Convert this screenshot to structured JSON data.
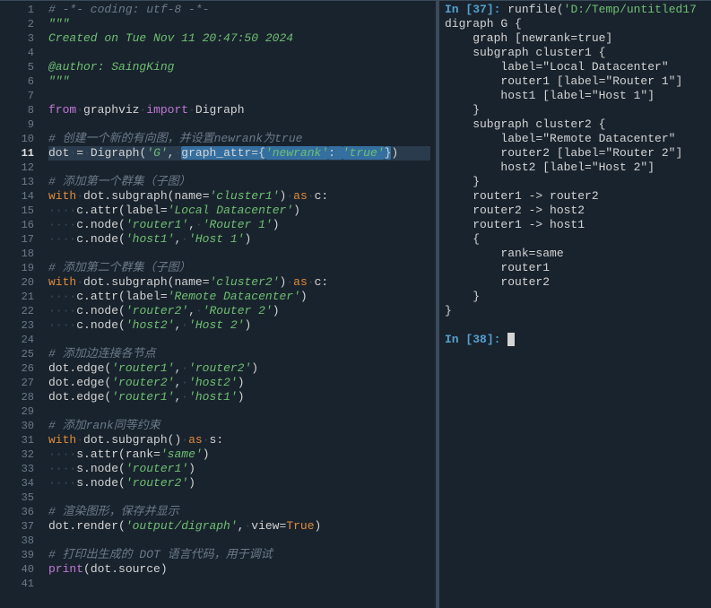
{
  "editor": {
    "current_line": 11,
    "lines": [
      {
        "n": 1,
        "seg": [
          [
            "com",
            "# -*- coding: utf-8 -*-"
          ]
        ],
        "ws": 0
      },
      {
        "n": 2,
        "seg": [
          [
            "str",
            "\"\"\""
          ]
        ],
        "ws": 0
      },
      {
        "n": 3,
        "seg": [
          [
            "str",
            "Created on Tue Nov 11 20:47:50 2024"
          ]
        ],
        "ws": 0
      },
      {
        "n": 4,
        "seg": [
          [
            "str",
            ""
          ]
        ],
        "ws": 0
      },
      {
        "n": 5,
        "seg": [
          [
            "str",
            "@author: SaingKing"
          ]
        ],
        "ws": 0
      },
      {
        "n": 6,
        "seg": [
          [
            "str",
            "\"\"\""
          ]
        ],
        "ws": 0
      },
      {
        "n": 7,
        "seg": [],
        "ws": 0
      },
      {
        "n": 8,
        "seg": [
          [
            "key",
            "from"
          ],
          [
            "pun",
            " "
          ],
          [
            "id",
            "graphviz"
          ],
          [
            "pun",
            " "
          ],
          [
            "key",
            "import"
          ],
          [
            "pun",
            " "
          ],
          [
            "id",
            "Digraph"
          ]
        ],
        "ws": 0
      },
      {
        "n": 9,
        "seg": [],
        "ws": 0
      },
      {
        "n": 10,
        "seg": [
          [
            "com",
            "# 创建一个新的有向图，并设置newrank为true"
          ]
        ],
        "ws": 0
      },
      {
        "n": 11,
        "hl": true,
        "seg": [
          [
            "id",
            "dot"
          ],
          [
            "pun",
            " = "
          ],
          [
            "id",
            "Digraph"
          ],
          [
            "pun",
            "("
          ],
          [
            "str",
            "'G'"
          ],
          [
            "pun",
            ", "
          ],
          [
            "sel",
            "graph_attr={"
          ],
          [
            "selstr",
            "'newrank'"
          ],
          [
            "sel",
            ": "
          ],
          [
            "selstr",
            "'true'"
          ],
          [
            "sel",
            "}"
          ],
          [
            "pun",
            ")"
          ]
        ],
        "ws": 0
      },
      {
        "n": 12,
        "seg": [],
        "ws": 0
      },
      {
        "n": 13,
        "seg": [
          [
            "com",
            "# 添加第一个群集（子图）"
          ]
        ],
        "ws": 0
      },
      {
        "n": 14,
        "seg": [
          [
            "kw2",
            "with"
          ],
          [
            "pun",
            " "
          ],
          [
            "id",
            "dot.subgraph"
          ],
          [
            "pun",
            "("
          ],
          [
            "id",
            "name"
          ],
          [
            "pun",
            "="
          ],
          [
            "str",
            "'cluster1'"
          ],
          [
            "pun",
            ") "
          ],
          [
            "kw2",
            "as"
          ],
          [
            "pun",
            " "
          ],
          [
            "id",
            "c"
          ],
          [
            "pun",
            ":"
          ]
        ],
        "ws": 0
      },
      {
        "n": 15,
        "seg": [
          [
            "id",
            "c.attr"
          ],
          [
            "pun",
            "("
          ],
          [
            "id",
            "label"
          ],
          [
            "pun",
            "="
          ],
          [
            "str",
            "'Local Datacenter'"
          ],
          [
            "pun",
            ")"
          ]
        ],
        "ws": 4
      },
      {
        "n": 16,
        "seg": [
          [
            "id",
            "c.node"
          ],
          [
            "pun",
            "("
          ],
          [
            "str",
            "'router1'"
          ],
          [
            "pun",
            ", "
          ],
          [
            "str",
            "'Router 1'"
          ],
          [
            "pun",
            ")"
          ]
        ],
        "ws": 4
      },
      {
        "n": 17,
        "seg": [
          [
            "id",
            "c.node"
          ],
          [
            "pun",
            "("
          ],
          [
            "str",
            "'host1'"
          ],
          [
            "pun",
            ", "
          ],
          [
            "str",
            "'Host 1'"
          ],
          [
            "pun",
            ")"
          ]
        ],
        "ws": 4
      },
      {
        "n": 18,
        "seg": [],
        "ws": 0
      },
      {
        "n": 19,
        "seg": [
          [
            "com",
            "# 添加第二个群集（子图）"
          ]
        ],
        "ws": 0
      },
      {
        "n": 20,
        "seg": [
          [
            "kw2",
            "with"
          ],
          [
            "pun",
            " "
          ],
          [
            "id",
            "dot.subgraph"
          ],
          [
            "pun",
            "("
          ],
          [
            "id",
            "name"
          ],
          [
            "pun",
            "="
          ],
          [
            "str",
            "'cluster2'"
          ],
          [
            "pun",
            ") "
          ],
          [
            "kw2",
            "as"
          ],
          [
            "pun",
            " "
          ],
          [
            "id",
            "c"
          ],
          [
            "pun",
            ":"
          ]
        ],
        "ws": 0
      },
      {
        "n": 21,
        "seg": [
          [
            "id",
            "c.attr"
          ],
          [
            "pun",
            "("
          ],
          [
            "id",
            "label"
          ],
          [
            "pun",
            "="
          ],
          [
            "str",
            "'Remote Datacenter'"
          ],
          [
            "pun",
            ")"
          ]
        ],
        "ws": 4
      },
      {
        "n": 22,
        "seg": [
          [
            "id",
            "c.node"
          ],
          [
            "pun",
            "("
          ],
          [
            "str",
            "'router2'"
          ],
          [
            "pun",
            ", "
          ],
          [
            "str",
            "'Router 2'"
          ],
          [
            "pun",
            ")"
          ]
        ],
        "ws": 4
      },
      {
        "n": 23,
        "seg": [
          [
            "id",
            "c.node"
          ],
          [
            "pun",
            "("
          ],
          [
            "str",
            "'host2'"
          ],
          [
            "pun",
            ", "
          ],
          [
            "str",
            "'Host 2'"
          ],
          [
            "pun",
            ")"
          ]
        ],
        "ws": 4
      },
      {
        "n": 24,
        "seg": [],
        "ws": 0
      },
      {
        "n": 25,
        "seg": [
          [
            "com",
            "# 添加边连接各节点"
          ]
        ],
        "ws": 0
      },
      {
        "n": 26,
        "seg": [
          [
            "id",
            "dot.edge"
          ],
          [
            "pun",
            "("
          ],
          [
            "str",
            "'router1'"
          ],
          [
            "pun",
            ", "
          ],
          [
            "str",
            "'router2'"
          ],
          [
            "pun",
            ")"
          ]
        ],
        "ws": 0
      },
      {
        "n": 27,
        "seg": [
          [
            "id",
            "dot.edge"
          ],
          [
            "pun",
            "("
          ],
          [
            "str",
            "'router2'"
          ],
          [
            "pun",
            ", "
          ],
          [
            "str",
            "'host2'"
          ],
          [
            "pun",
            ")"
          ]
        ],
        "ws": 0
      },
      {
        "n": 28,
        "seg": [
          [
            "id",
            "dot.edge"
          ],
          [
            "pun",
            "("
          ],
          [
            "str",
            "'router1'"
          ],
          [
            "pun",
            ", "
          ],
          [
            "str",
            "'host1'"
          ],
          [
            "pun",
            ")"
          ]
        ],
        "ws": 0
      },
      {
        "n": 29,
        "seg": [],
        "ws": 0
      },
      {
        "n": 30,
        "seg": [
          [
            "com",
            "# 添加rank同等约束"
          ]
        ],
        "ws": 0
      },
      {
        "n": 31,
        "seg": [
          [
            "kw2",
            "with"
          ],
          [
            "pun",
            " "
          ],
          [
            "id",
            "dot.subgraph"
          ],
          [
            "pun",
            "() "
          ],
          [
            "kw2",
            "as"
          ],
          [
            "pun",
            " "
          ],
          [
            "id",
            "s"
          ],
          [
            "pun",
            ":"
          ]
        ],
        "ws": 0
      },
      {
        "n": 32,
        "seg": [
          [
            "id",
            "s.attr"
          ],
          [
            "pun",
            "("
          ],
          [
            "id",
            "rank"
          ],
          [
            "pun",
            "="
          ],
          [
            "str",
            "'same'"
          ],
          [
            "pun",
            ")"
          ]
        ],
        "ws": 4
      },
      {
        "n": 33,
        "seg": [
          [
            "id",
            "s.node"
          ],
          [
            "pun",
            "("
          ],
          [
            "str",
            "'router1'"
          ],
          [
            "pun",
            ")"
          ]
        ],
        "ws": 4
      },
      {
        "n": 34,
        "seg": [
          [
            "id",
            "s.node"
          ],
          [
            "pun",
            "("
          ],
          [
            "str",
            "'router2'"
          ],
          [
            "pun",
            ")"
          ]
        ],
        "ws": 4
      },
      {
        "n": 35,
        "seg": [],
        "ws": 0
      },
      {
        "n": 36,
        "seg": [
          [
            "com",
            "# 渲染图形，保存并显示"
          ]
        ],
        "ws": 0
      },
      {
        "n": 37,
        "seg": [
          [
            "id",
            "dot.render"
          ],
          [
            "pun",
            "("
          ],
          [
            "str",
            "'output/digraph'"
          ],
          [
            "pun",
            ", "
          ],
          [
            "id",
            "view"
          ],
          [
            "pun",
            "="
          ],
          [
            "bool",
            "True"
          ],
          [
            "pun",
            ")"
          ]
        ],
        "ws": 0
      },
      {
        "n": 38,
        "seg": [],
        "ws": 0
      },
      {
        "n": 39,
        "seg": [
          [
            "com",
            "# 打印出生成的 DOT 语言代码，用于调试"
          ]
        ],
        "ws": 0
      },
      {
        "n": 40,
        "seg": [
          [
            "key",
            "print"
          ],
          [
            "pun",
            "("
          ],
          [
            "id",
            "dot.source"
          ],
          [
            "pun",
            ")"
          ]
        ],
        "ws": 0
      },
      {
        "n": 41,
        "seg": [],
        "ws": 0
      }
    ]
  },
  "console": {
    "blocks": [
      {
        "type": "in",
        "n": "37",
        "cmd_pre": "runfile(",
        "cmd_str": "'D:/Temp/untitled17",
        "out": [
          "digraph G {",
          "    graph [newrank=true]",
          "    subgraph cluster1 {",
          "        label=\"Local Datacenter\"",
          "        router1 [label=\"Router 1\"]",
          "        host1 [label=\"Host 1\"]",
          "    }",
          "    subgraph cluster2 {",
          "        label=\"Remote Datacenter\"",
          "        router2 [label=\"Router 2\"]",
          "        host2 [label=\"Host 2\"]",
          "    }",
          "    router1 -> router2",
          "    router2 -> host2",
          "    router1 -> host1",
          "    {",
          "        rank=same",
          "        router1",
          "        router2",
          "    }",
          "}",
          ""
        ]
      },
      {
        "type": "in-empty",
        "n": "38"
      }
    ]
  }
}
